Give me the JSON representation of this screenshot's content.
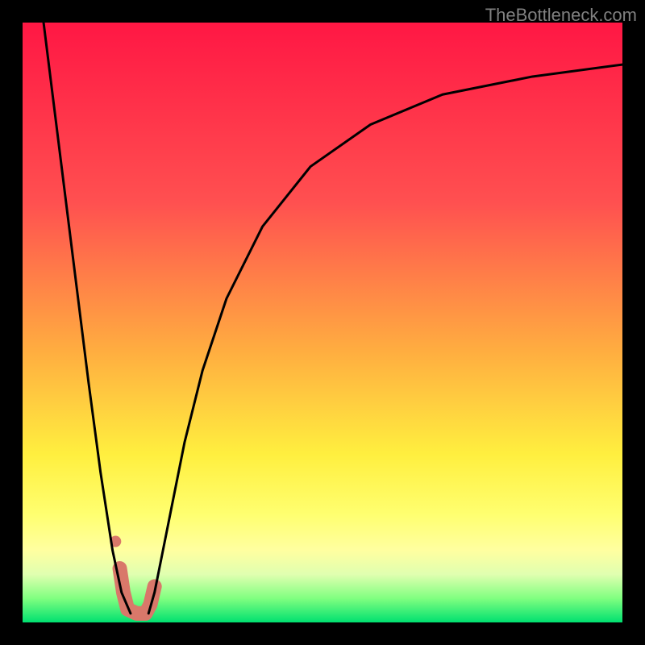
{
  "watermark_text": "TheBottleneck.com",
  "chart_data": {
    "type": "line",
    "title": "",
    "xlabel": "",
    "ylabel": "",
    "xlim": [
      0,
      100
    ],
    "ylim": [
      0,
      100
    ],
    "gradient_stops": [
      {
        "offset": 0,
        "color": "#ff1744"
      },
      {
        "offset": 30,
        "color": "#ff5050"
      },
      {
        "offset": 55,
        "color": "#ffae40"
      },
      {
        "offset": 72,
        "color": "#ffef3f"
      },
      {
        "offset": 82,
        "color": "#ffff70"
      },
      {
        "offset": 88,
        "color": "#ffffa0"
      },
      {
        "offset": 92,
        "color": "#e0ffb0"
      },
      {
        "offset": 96,
        "color": "#80ff80"
      },
      {
        "offset": 100,
        "color": "#00e070"
      }
    ],
    "series": [
      {
        "name": "left-curve",
        "color": "#000000",
        "stroke_width": 3,
        "points": [
          {
            "x": 3.5,
            "y": 100
          },
          {
            "x": 5,
            "y": 88
          },
          {
            "x": 7,
            "y": 72
          },
          {
            "x": 9,
            "y": 56
          },
          {
            "x": 11,
            "y": 40
          },
          {
            "x": 13,
            "y": 25
          },
          {
            "x": 15,
            "y": 12
          },
          {
            "x": 16.5,
            "y": 5
          },
          {
            "x": 18,
            "y": 1.5
          }
        ]
      },
      {
        "name": "right-curve",
        "color": "#000000",
        "stroke_width": 3,
        "points": [
          {
            "x": 21,
            "y": 1.5
          },
          {
            "x": 22,
            "y": 5
          },
          {
            "x": 24,
            "y": 15
          },
          {
            "x": 27,
            "y": 30
          },
          {
            "x": 30,
            "y": 42
          },
          {
            "x": 34,
            "y": 54
          },
          {
            "x": 40,
            "y": 66
          },
          {
            "x": 48,
            "y": 76
          },
          {
            "x": 58,
            "y": 83
          },
          {
            "x": 70,
            "y": 88
          },
          {
            "x": 85,
            "y": 91
          },
          {
            "x": 100,
            "y": 93
          }
        ]
      }
    ],
    "highlight_segment": {
      "color": "#d9786a",
      "stroke_width": 18,
      "points": [
        {
          "x": 16.2,
          "y": 9
        },
        {
          "x": 16.8,
          "y": 5
        },
        {
          "x": 17.5,
          "y": 2.2
        },
        {
          "x": 19,
          "y": 1.5
        },
        {
          "x": 20.5,
          "y": 1.5
        },
        {
          "x": 21.3,
          "y": 3
        },
        {
          "x": 22,
          "y": 6
        }
      ]
    },
    "highlight_dots": {
      "color": "#d9786a",
      "radius": 7,
      "points": [
        {
          "x": 15.5,
          "y": 13.5
        },
        {
          "x": 16.3,
          "y": 9
        }
      ]
    }
  }
}
